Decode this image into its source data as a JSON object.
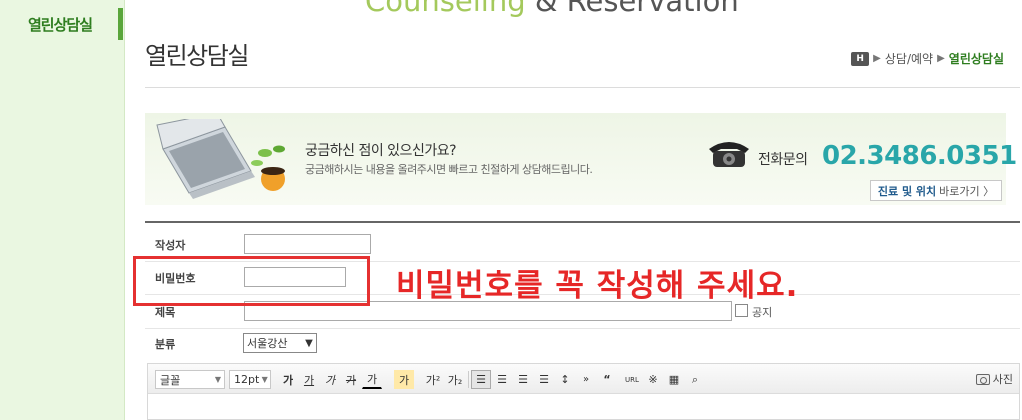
{
  "banner": {
    "word1": "Counseling",
    "word2": " & Reservation"
  },
  "sidebar": {
    "active_item": "열린상담실"
  },
  "page": {
    "title": "열린상담실"
  },
  "breadcrumb": {
    "home": "H",
    "items": [
      "상담/예약",
      "열린상담실"
    ]
  },
  "info": {
    "question": "궁금하신 점이 있으신가요?",
    "sub": "궁금해하시는 내용을 올려주시면 빠르고 친절하게 상담해드립니다.",
    "phone_label": "전화문의",
    "phone_number": "02.3486.0351",
    "location_bold": "진료 및 위치",
    "location_rest": "바로가기 〉"
  },
  "form": {
    "author_label": "작성자",
    "author_value": "",
    "password_label": "비밀번호",
    "password_value": "",
    "subject_label": "제목",
    "subject_value": "",
    "notice_label": "공지",
    "category_label": "분류",
    "category_value": "서울강산"
  },
  "annotation": {
    "text": "비밀번호를 꼭 작성해 주세요."
  },
  "editor": {
    "font_family": "글꼴",
    "font_size": "12pt",
    "buttons": [
      "가",
      "가",
      "가",
      "가",
      "가",
      "가",
      "가²",
      "가₂"
    ],
    "photo": "사진",
    "url": "URL"
  },
  "colors": {
    "accent_green": "#2e7d1f",
    "phone_teal": "#29a6a9",
    "annotation_red": "#e62727"
  }
}
